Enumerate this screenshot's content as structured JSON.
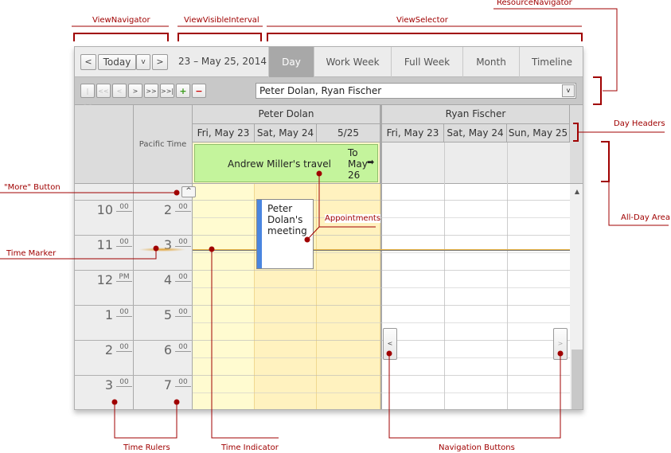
{
  "toolbar": {
    "prev": "<",
    "today": "Today",
    "dropdown": "v",
    "next": ">",
    "interval": "23 – May 25, 2014",
    "views": [
      "Day",
      "Work Week",
      "Full Week",
      "Month",
      "Timeline"
    ],
    "active_view": "Day"
  },
  "resource_nav": {
    "buttons": [
      "|<<",
      "<<",
      "<",
      ">",
      ">>",
      ">>|",
      "+",
      "−"
    ],
    "combo_value": "Peter Dolan, Ryan Fischer"
  },
  "header": {
    "time_zone": "Pacific Time",
    "resources": [
      {
        "name": "Peter Dolan",
        "days": [
          "Fri, May 23",
          "Sat, May 24",
          "5/25"
        ]
      },
      {
        "name": "Ryan Fischer",
        "days": [
          "Fri, May 23",
          "Sat, May 24",
          "Sun, May 25"
        ]
      }
    ]
  },
  "all_day": {
    "subject": "Andrew Miller's travel",
    "continues": "To May 26",
    "continue_icon": "arrow-right-icon"
  },
  "appointment": {
    "subject": "Peter Dolan's meeting",
    "status_color": "#4a86e0"
  },
  "rulers": {
    "left": [
      {
        "h": "10",
        "m": "00"
      },
      {
        "h": "11",
        "m": "00"
      },
      {
        "h": "12",
        "m": "PM"
      },
      {
        "h": "1",
        "m": "00"
      },
      {
        "h": "2",
        "m": "00"
      },
      {
        "h": "3",
        "m": "00"
      }
    ],
    "right": [
      {
        "h": "2",
        "m": "00"
      },
      {
        "h": "3",
        "m": "00"
      },
      {
        "h": "4",
        "m": "00"
      },
      {
        "h": "5",
        "m": "00"
      },
      {
        "h": "6",
        "m": "00"
      },
      {
        "h": "7",
        "m": "00"
      }
    ]
  },
  "annotations": {
    "view_navigator": "ViewNavigator",
    "view_visible_interval": "ViewVisibleInterval",
    "view_selector": "ViewSelector",
    "resource_navigator": "ResourceNavigator",
    "day_headers": "Day Headers",
    "all_day_area": "All-Day Area",
    "more_button": "\"More\" Button",
    "time_marker": "Time Marker",
    "appointments": "Appointments",
    "time_rulers": "Time Rulers",
    "time_indicator": "Time Indicator",
    "navigation_buttons": "Navigation Buttons"
  },
  "colors": {
    "annotation": "#a00000",
    "work_hours": "#fffbd0",
    "non_work": "#fff2bf",
    "all_day_appt": "#c4f49c",
    "active_tab": "#a8a8a8"
  }
}
